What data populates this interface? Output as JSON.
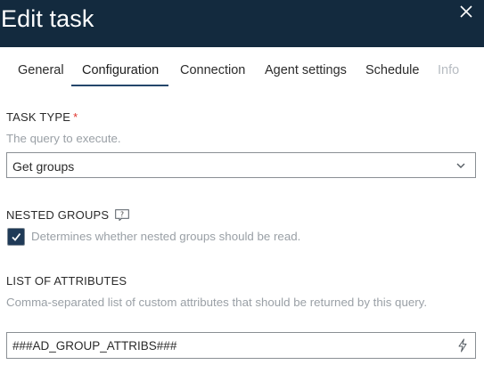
{
  "dialog": {
    "title": "Edit task",
    "close_icon": "close-icon"
  },
  "tabs": [
    {
      "label": "General",
      "state": "normal"
    },
    {
      "label": "Configuration",
      "state": "active"
    },
    {
      "label": "Connection",
      "state": "normal"
    },
    {
      "label": "Agent settings",
      "state": "normal"
    },
    {
      "label": "Schedule",
      "state": "normal"
    },
    {
      "label": "Info",
      "state": "disabled"
    }
  ],
  "task_type": {
    "label": "TASK TYPE",
    "required_marker": "*",
    "help": "The query to execute.",
    "value": "Get groups",
    "dropdown_icon": "chevron-down-icon"
  },
  "nested_groups": {
    "label": "NESTED GROUPS",
    "info_icon": "help-tooltip-icon",
    "checked": true,
    "help": "Determines whether nested groups should be read."
  },
  "attributes": {
    "label": "LIST OF ATTRIBUTES",
    "help": "Comma-separated list of custom attributes that should be returned by this query.",
    "value": "###AD_GROUP_ATTRIBS###",
    "action_icon": "lightning-bolt-icon"
  },
  "colors": {
    "header_bg": "#132a3e",
    "accent": "#24466b",
    "required": "#e0322b",
    "checkbox_bg": "#1f3a57"
  }
}
